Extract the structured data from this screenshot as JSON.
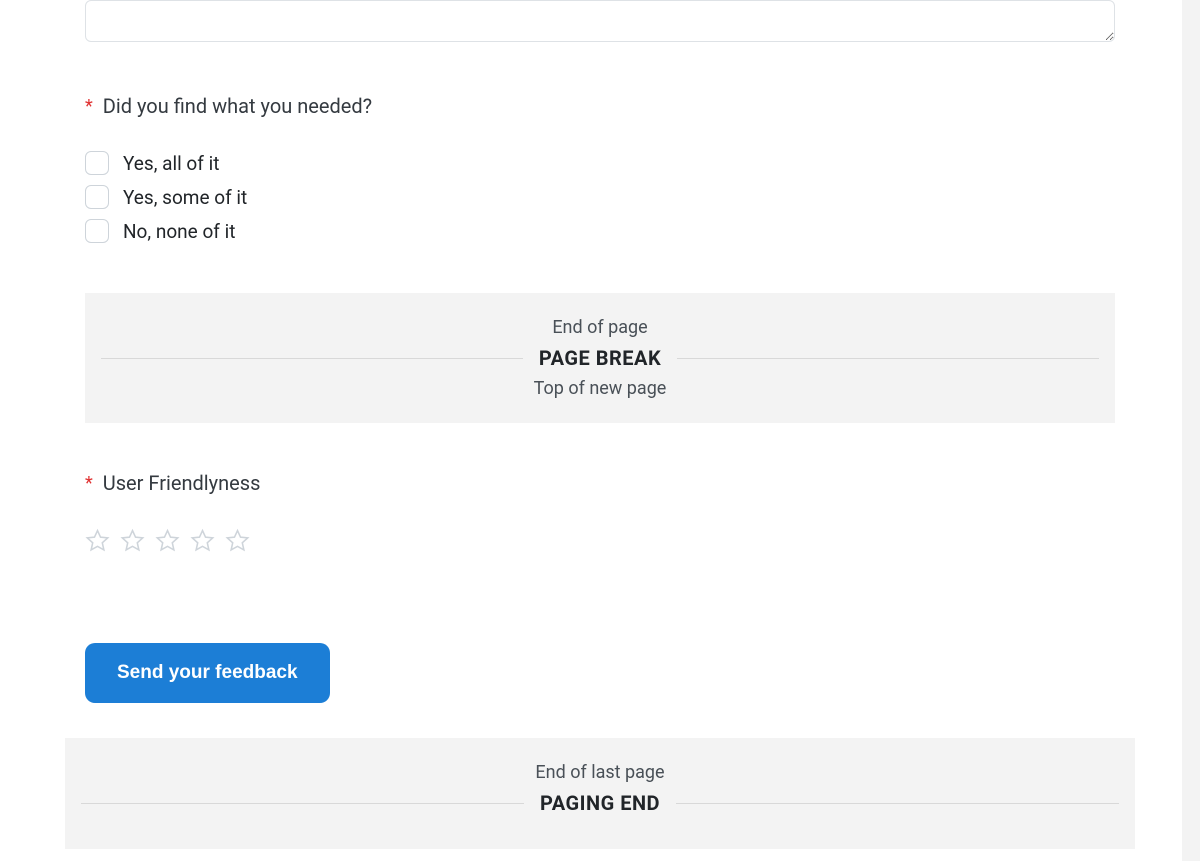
{
  "question1": {
    "label": "Did you find what you needed?",
    "options": [
      "Yes, all of it",
      "Yes, some of it",
      "No, none of it"
    ]
  },
  "pageBreak": {
    "top": "End of page",
    "label": "PAGE BREAK",
    "bottom": "Top of new page"
  },
  "question2": {
    "label": "User Friendlyness"
  },
  "submit": {
    "label": "Send your feedback"
  },
  "pagingEnd": {
    "top": "End of last page",
    "label": "PAGING END"
  },
  "required": "*"
}
